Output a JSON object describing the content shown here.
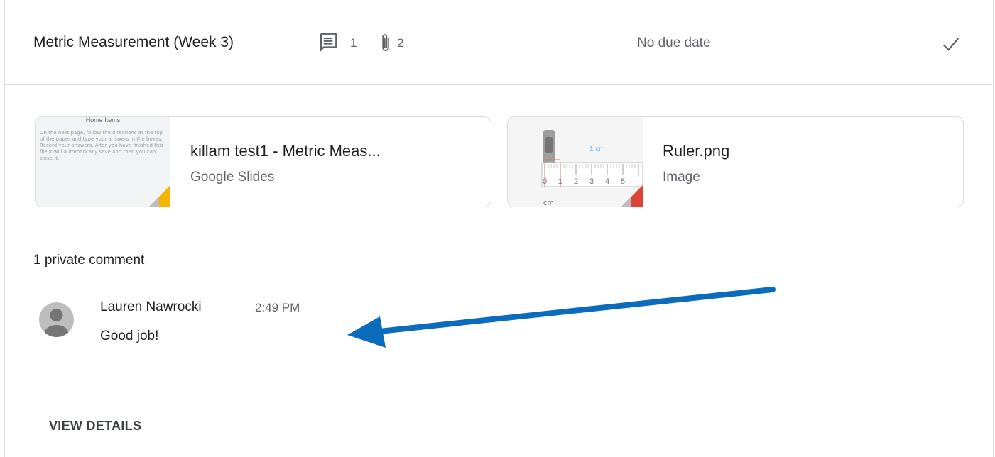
{
  "assignment": {
    "title": "Metric Measurement (Week 3)",
    "comment_count": "1",
    "attachment_count": "2",
    "due": "No due date"
  },
  "attachments": [
    {
      "title": "killam test1 - Metric Meas...",
      "type": "Google Slides",
      "thumb_heading": "Home Items",
      "thumb_lines": "On the next page, follow the directions at the top of the paper and type your answers in the boxes. Record your answers. After you have finished this file it will automatically save and then you can close it.",
      "corner_color": "#f4b400"
    },
    {
      "title": "Ruler.png",
      "type": "Image",
      "thumb_unit": "1 cm",
      "thumb_label": "cm",
      "thumb_ticks": [
        "0",
        "1",
        "2",
        "3",
        "4",
        "5"
      ],
      "corner_color": "#db4437"
    }
  ],
  "comments_section": {
    "heading": "1 private comment",
    "comments": [
      {
        "author": "Lauren Nawrocki",
        "time": "2:49 PM",
        "text": "Good job!"
      }
    ]
  },
  "footer": {
    "view_details": "VIEW DETAILS"
  },
  "colors": {
    "arrow": "#0b6bbd",
    "divider": "#dadce0"
  },
  "icons": [
    "comment-icon",
    "paperclip-icon",
    "check-icon",
    "avatar-person-icon",
    "arrow-annotation"
  ]
}
